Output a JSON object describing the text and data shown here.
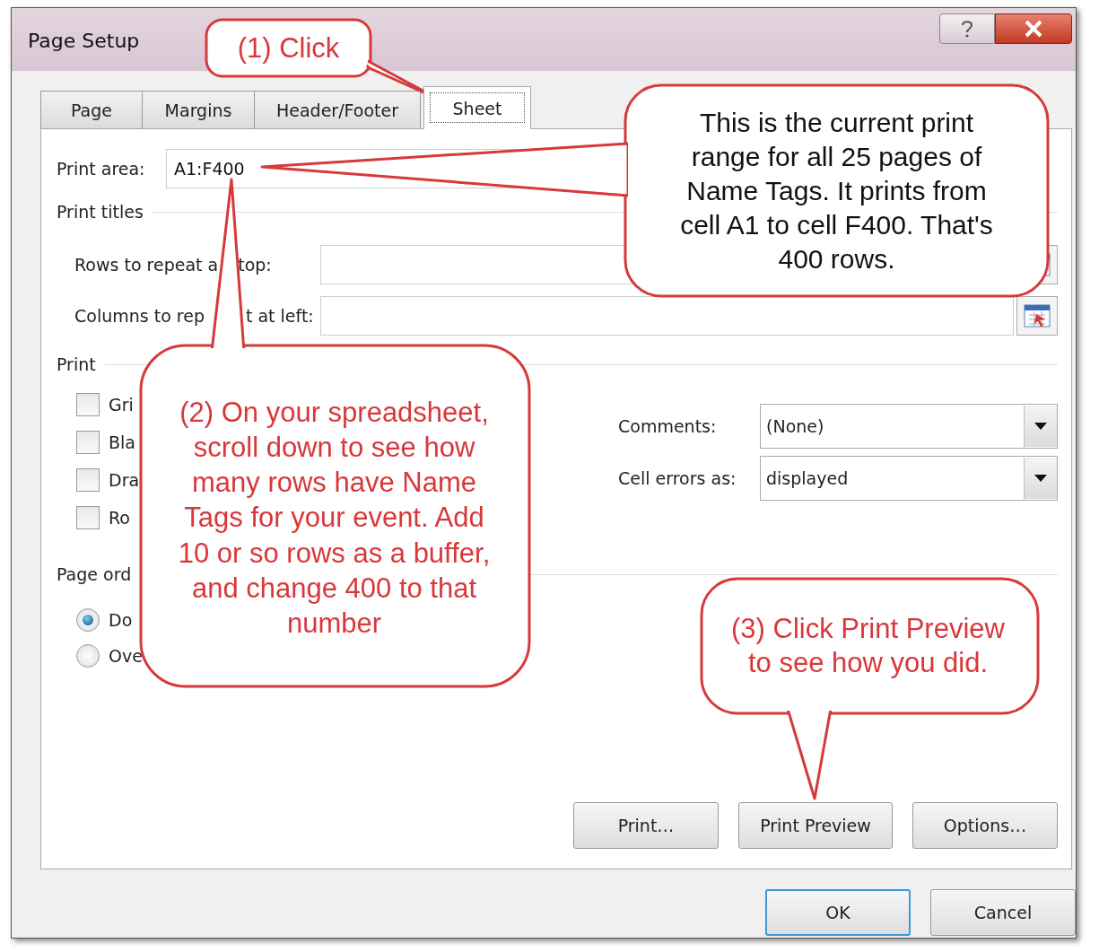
{
  "window": {
    "title": "Page Setup"
  },
  "tabs": [
    {
      "label": "Page",
      "selected": false
    },
    {
      "label": "Margins",
      "selected": false
    },
    {
      "label": "Header/Footer",
      "selected": false
    },
    {
      "label": "Sheet",
      "selected": true
    }
  ],
  "print_area": {
    "label": "Print area:",
    "value": "A1:F400"
  },
  "print_titles": {
    "heading": "Print titles",
    "fields": [
      {
        "label_parts": [
          "Rows to repeat a",
          "top:"
        ]
      },
      {
        "label_parts": [
          "Columns to rep",
          "t at left:"
        ]
      }
    ]
  },
  "print": {
    "heading": "Print",
    "checkboxes": [
      {
        "label": "Gri",
        "checked": false
      },
      {
        "label": "Bla",
        "checked": false
      },
      {
        "label": "Dra",
        "checked": false
      },
      {
        "label": "Ro",
        "checked": false
      }
    ],
    "dropdowns": [
      {
        "label": "Comments:",
        "value": "(None)"
      },
      {
        "label": "Cell errors as:",
        "value": "displayed"
      }
    ]
  },
  "page_order": {
    "heading": "Page ord",
    "options": [
      {
        "label": "Do",
        "selected": true
      },
      {
        "label": "Ove",
        "selected": false
      }
    ]
  },
  "panel_buttons": [
    "Print…",
    "Print Preview",
    "Options…"
  ],
  "buttons": [
    {
      "label": "OK",
      "default": true
    },
    {
      "label": "Cancel",
      "default": false
    }
  ],
  "callouts": [
    {
      "text": "(1) Click"
    },
    {
      "text": "This is the current print range for all 25 pages of Name Tags.  It prints from cell A1 to cell F400.  That's 400 rows."
    },
    {
      "text": "(2) On your spreadsheet, scroll down to see how many rows have Name Tags for your event.  Add 10 or so rows as a buffer, and change 400 to that number"
    },
    {
      "text": "(3) Click Print Preview to see how you did."
    }
  ]
}
